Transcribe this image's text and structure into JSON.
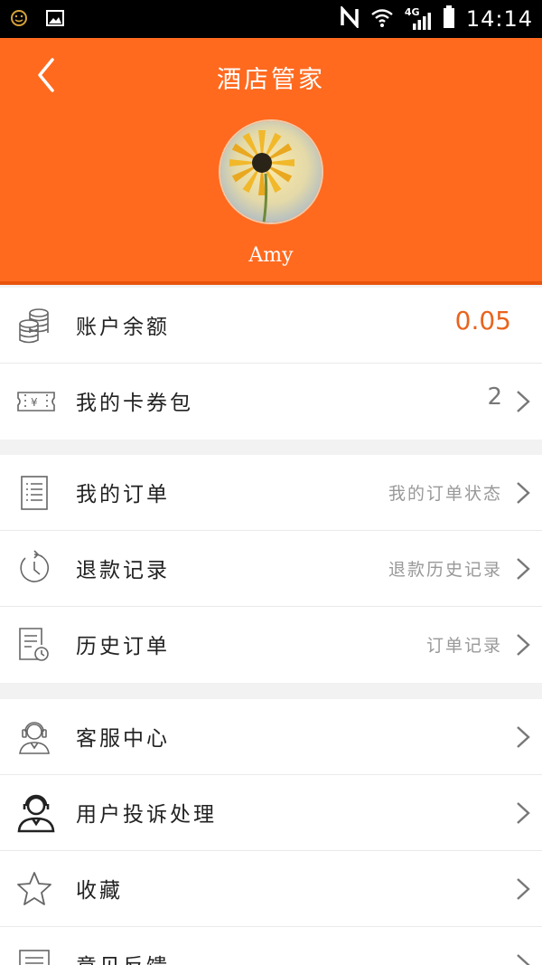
{
  "status_bar": {
    "time": "14:14",
    "network": "4G",
    "icons": [
      "emoji-icon",
      "image-icon",
      "nfc-icon",
      "wifi-icon",
      "signal-icon",
      "battery-icon"
    ]
  },
  "header": {
    "title": "酒店管家",
    "username": "Amy",
    "background_color": "#ff6a1f"
  },
  "account": {
    "balance": {
      "label": "账户余额",
      "value": "0.05",
      "icon": "coins-icon"
    },
    "coupons": {
      "label": "我的卡券包",
      "value": "2",
      "icon": "ticket-icon"
    }
  },
  "orders": {
    "items": [
      {
        "label": "我的订单",
        "value": "我的订单状态",
        "icon": "list-icon"
      },
      {
        "label": "退款记录",
        "value": "退款历史记录",
        "icon": "history-clock-icon"
      },
      {
        "label": "历史订单",
        "value": "订单记录",
        "icon": "document-clock-icon"
      }
    ]
  },
  "services": {
    "items": [
      {
        "label": "客服中心",
        "value": "",
        "icon": "headset-icon"
      },
      {
        "label": "用户投诉处理",
        "value": "",
        "icon": "user-headset-icon"
      },
      {
        "label": "收藏",
        "value": "",
        "icon": "star-icon"
      },
      {
        "label": "意见反馈",
        "value": "",
        "icon": "feedback-icon"
      }
    ]
  },
  "accent_color": "#e8641e"
}
